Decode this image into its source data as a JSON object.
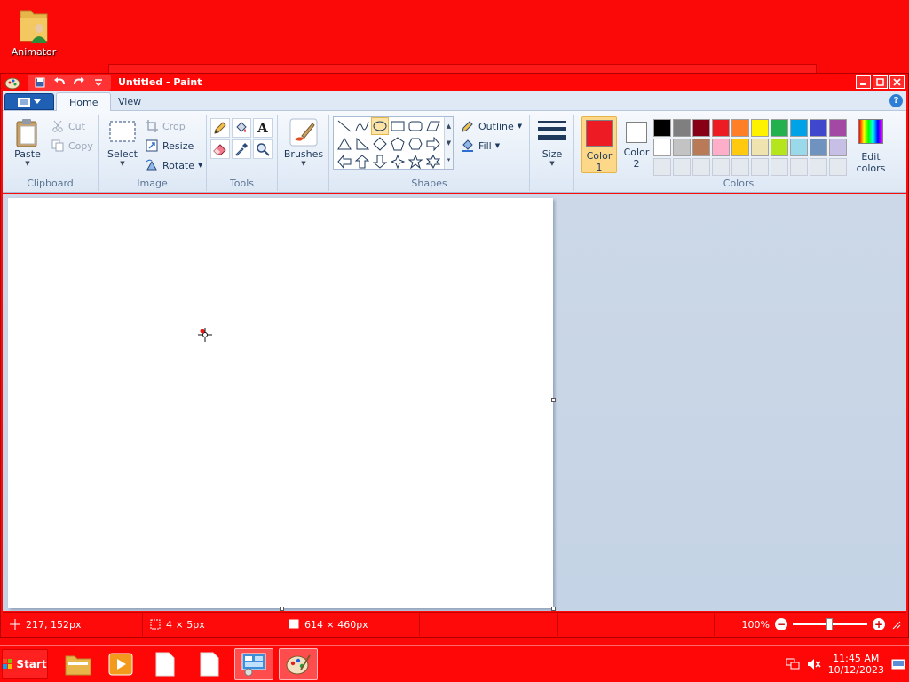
{
  "desktop": {
    "icon_label": "Animator"
  },
  "window": {
    "title": "Untitled - Paint"
  },
  "ribbon": {
    "tabs": [
      "Home",
      "View"
    ],
    "help": "?",
    "clipboard": {
      "label": "Clipboard",
      "paste": "Paste",
      "cut": "Cut",
      "copy": "Copy"
    },
    "image": {
      "label": "Image",
      "select": "Select",
      "crop": "Crop",
      "resize": "Resize",
      "rotate": "Rotate"
    },
    "tools": {
      "label": "Tools",
      "text_tool": "A"
    },
    "brushes": {
      "label": "Brushes"
    },
    "shapes": {
      "label": "Shapes",
      "outline": "Outline",
      "fill": "Fill"
    },
    "size": {
      "label": "Size"
    },
    "colors": {
      "label": "Colors",
      "color1": "Color\n1",
      "color1_line1": "Color",
      "color1_line2": "1",
      "color2_line1": "Color",
      "color2_line2": "2",
      "edit_line1": "Edit",
      "edit_line2": "colors",
      "color1_value": "#ed1c24",
      "color2_value": "#ffffff",
      "palette_row1": [
        "#000000",
        "#7f7f7f",
        "#880015",
        "#ed1c24",
        "#ff7f27",
        "#fff200",
        "#22b14c",
        "#00a2e8",
        "#3f48cc",
        "#a349a4"
      ],
      "palette_row2": [
        "#ffffff",
        "#c3c3c3",
        "#b97a57",
        "#ffaec9",
        "#ffc90e",
        "#efe4b0",
        "#b5e61d",
        "#99d9ea",
        "#7092be",
        "#c8bfe7"
      ]
    }
  },
  "status": {
    "cursor_pos": "217, 152px",
    "selection_size": "4 × 5px",
    "canvas_size": "614 × 460px",
    "zoom": "100%"
  },
  "taskbar": {
    "start": "Start",
    "time": "11:45 AM",
    "date": "10/12/2023"
  }
}
